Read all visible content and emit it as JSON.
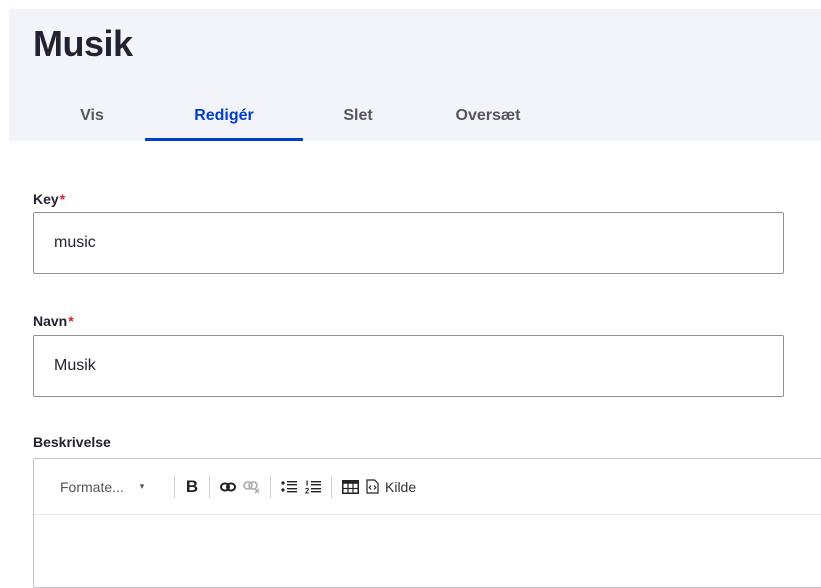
{
  "header": {
    "title": "Musik",
    "tabs": [
      {
        "label": "Vis"
      },
      {
        "label": "Redigér"
      },
      {
        "label": "Slet"
      },
      {
        "label": "Oversæt"
      }
    ]
  },
  "form": {
    "key": {
      "label": "Key",
      "required": "*",
      "value": "music"
    },
    "name": {
      "label": "Navn",
      "required": "*",
      "value": "Musik"
    },
    "description": {
      "label": "Beskrivelse",
      "toolbar": {
        "format_label": "Formate...",
        "caret": "▾",
        "bold": "B",
        "source_label": "Kilde"
      }
    }
  },
  "colors": {
    "accent": "#003ecc",
    "required": "#d72222",
    "header_bg": "#f3f4f9"
  }
}
